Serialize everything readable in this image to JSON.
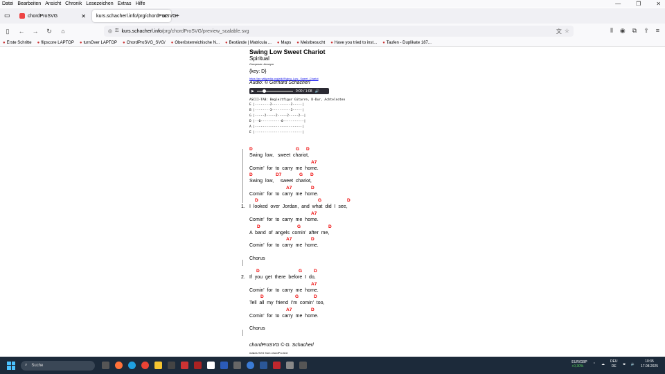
{
  "menu": [
    "Datei",
    "Bearbeiten",
    "Ansicht",
    "Chronik",
    "Lesezeichen",
    "Extras",
    "Hilfe"
  ],
  "tabs": [
    {
      "label": "chordProSVG",
      "active": false
    },
    {
      "label": "kurs.schacherl.info/prg/chordProSVG",
      "active": true
    }
  ],
  "url": {
    "host": "kurs.schacherl.info",
    "path": "/prg/chordProSVG/preview_scalable.svg"
  },
  "bookmarks": [
    "Erste Schritte",
    "flipscore LAPTOP",
    "turnOver LAPTOP",
    "ChordProSVG_SVG/",
    "Oberösterreichische N...",
    "Bestände | Matricula ...",
    "Maps",
    "Meistbesucht",
    "Have you tried to inst...",
    "Taufen - Duplikate 187..."
  ],
  "song": {
    "title": "Swing Low Sweet Chariot",
    "subtitle": "Spiritual",
    "composer": "Composer: Anonym",
    "key": "{key:  D}",
    "wiki": "https://en.wikipedia.org/wiki/Swing_Low,_Sweet_Chariot",
    "audio_credit": "Audio: © Gerhard Schacherl",
    "player_time": "0:00 / 1:08",
    "ascii_title": "ASCII-TAB: Begleitfigur Gitarre, D-Dur, Achtelnoten",
    "ascii_lines": [
      "E |--------2----------2-----|",
      "B |--------3----------3-----|",
      "G |-----2-----2-----2-----2--|",
      "D |--0-----------0-----------|",
      "A |-------------------------|",
      "E |-------------------------|"
    ],
    "lines": [
      {
        "chords": [
          "D",
          "G",
          "D"
        ],
        "lyric": "Swing  low,   sweet  chariot,"
      },
      {
        "chords": [
          "A7"
        ],
        "lyric": "Comin'  for  to  carry  me  home."
      },
      {
        "chords": [
          "D",
          "D7",
          "G",
          "D"
        ],
        "lyric": "Swing  low,     sweet  chariot,"
      },
      {
        "chords": [
          "A7",
          "D"
        ],
        "lyric": "Comin'  for  to  carry  me  home."
      },
      {
        "num": "1.",
        "chords": [
          "D",
          "G",
          "D"
        ],
        "lyric": "I  looked  over  Jordan,  and  what  did  I  see,"
      },
      {
        "chords": [
          "A7"
        ],
        "lyric": "Comin'  for  to  carry  me  home."
      },
      {
        "chords": [
          "D",
          "G",
          "D"
        ],
        "lyric": "A  band  of  angels  comin'  after  me,"
      },
      {
        "chords": [
          "A7",
          "D"
        ],
        "lyric": "Comin'  for  to  carry  me  home."
      },
      {
        "lyric": "Chorus"
      },
      {
        "num": "2.",
        "chords": [
          "D",
          "G",
          "D"
        ],
        "lyric": "If  you  get  there  before  I  do,"
      },
      {
        "chords": [
          "A7"
        ],
        "lyric": "Comin'  for  to  carry  me  home."
      },
      {
        "chords": [
          "D",
          "G",
          "D"
        ],
        "lyric": "Tell  all  my  friend  I'm  comin'  too,"
      },
      {
        "chords": [
          "A7",
          "D"
        ],
        "lyric": "Comin'  for  to  carry  me  home."
      },
      {
        "lyric": "Chorus"
      }
    ],
    "footer": "chordProSVG © G. Schacherl",
    "footer_small": "makes SVG from chordPro text"
  },
  "taskbar": {
    "search": "Suche",
    "fx_pair": "EUR/GBP",
    "fx_change": "+0,30%",
    "lang": "DEU",
    "lang2": "DE",
    "time": "10:35",
    "date": "17.08.2025"
  }
}
